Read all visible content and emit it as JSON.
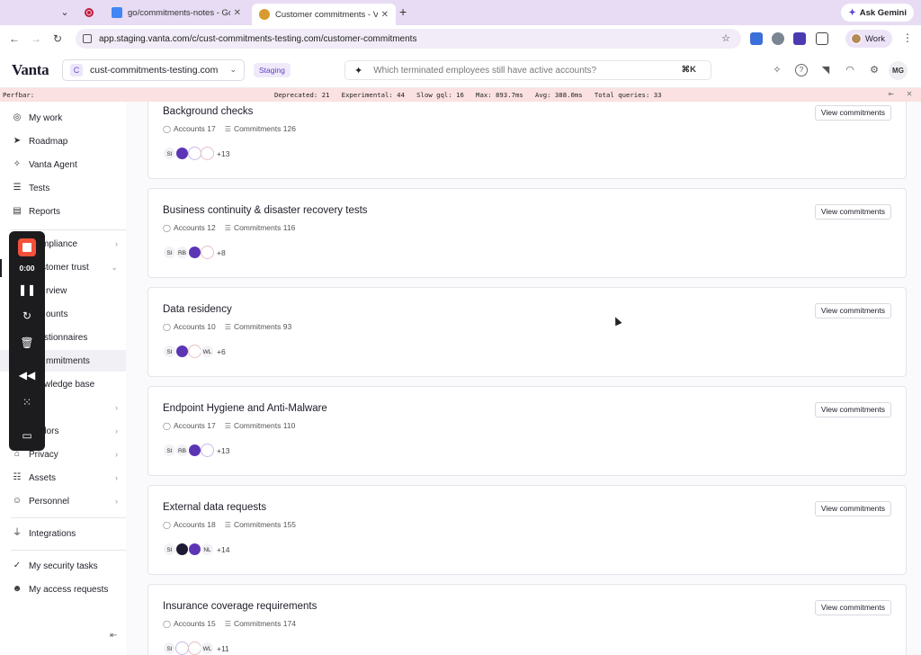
{
  "browser": {
    "tabs": [
      {
        "label": "go/commitments-notes - Goo",
        "favicon_color": "#4285f4"
      },
      {
        "label": "Customer commitments - Van",
        "favicon_color": "#d69b2c"
      }
    ],
    "url": "app.staging.vanta.com/c/cust-commitments-testing.com/customer-commitments",
    "ask_gemini": "Ask Gemini",
    "profile": "Work"
  },
  "header": {
    "logo": "Vanta",
    "org_initial": "C",
    "org": "cust-commitments-testing.com",
    "env_badge": "Staging",
    "search_placeholder": "Which terminated employees still have active accounts?",
    "shortcut": "⌘K",
    "user_initials": "MG"
  },
  "perfbar": {
    "label": "Perfbar:",
    "stats": "Deprecated: 21   Experimental: 44   Slow gql: 16   Max: 893.7ms   Avg: 388.0ms   Total queries: 33"
  },
  "sidebar": {
    "items": [
      {
        "label": "My work",
        "icon": "check-circle-icon"
      },
      {
        "label": "Roadmap",
        "icon": "send-icon"
      },
      {
        "label": "Vanta Agent",
        "icon": "sparkle-icon"
      },
      {
        "label": "Tests",
        "icon": "list-icon"
      },
      {
        "label": "Reports",
        "icon": "chart-icon"
      },
      {
        "label": "mpliance"
      },
      {
        "label": "stomer trust"
      },
      {
        "label": "rview"
      },
      {
        "label": "ounts"
      },
      {
        "label": "stionnaires"
      },
      {
        "label": "mmitments"
      },
      {
        "label": "wledge base"
      },
      {
        "label": "dors"
      },
      {
        "label": "Privacy",
        "icon": "lock-icon"
      },
      {
        "label": "Assets",
        "icon": "stack-icon"
      },
      {
        "label": "Personnel",
        "icon": "people-icon"
      },
      {
        "label": "Integrations",
        "icon": "plug-icon"
      },
      {
        "label": "My security tasks",
        "icon": "user-check-icon"
      },
      {
        "label": "My access requests",
        "icon": "user-key-icon"
      }
    ]
  },
  "recorder": {
    "time": "0:00"
  },
  "commitments": {
    "view_label": "View commitments",
    "accounts_label": "Accounts",
    "commitments_label": "Commitments",
    "cards": [
      {
        "title": "Background checks",
        "accounts": "17",
        "commitments": "126",
        "avatars": [
          "SI",
          "",
          "",
          ""
        ],
        "more": "+13"
      },
      {
        "title": "Business continuity & disaster recovery tests",
        "accounts": "12",
        "commitments": "116",
        "avatars": [
          "SI",
          "RB",
          "",
          ""
        ],
        "more": "+8"
      },
      {
        "title": "Data residency",
        "accounts": "10",
        "commitments": "93",
        "avatars": [
          "SI",
          "",
          "",
          "WL"
        ],
        "more": "+6"
      },
      {
        "title": "Endpoint Hygiene and Anti-Malware",
        "accounts": "17",
        "commitments": "110",
        "avatars": [
          "SI",
          "RB",
          "",
          ""
        ],
        "more": "+13"
      },
      {
        "title": "External data requests",
        "accounts": "18",
        "commitments": "155",
        "avatars": [
          "SI",
          "",
          "",
          "NL"
        ],
        "more": "+14"
      },
      {
        "title": "Insurance coverage requirements",
        "accounts": "15",
        "commitments": "174",
        "avatars": [
          "SI",
          "",
          "",
          "WL"
        ],
        "more": "+11"
      }
    ]
  }
}
